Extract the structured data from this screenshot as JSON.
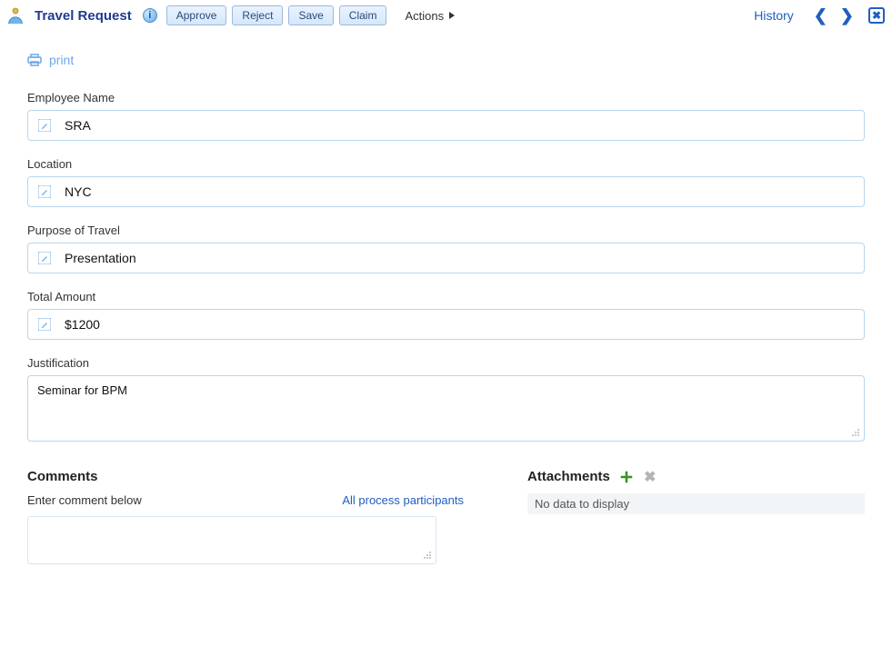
{
  "header": {
    "title": "Travel Request",
    "buttons": {
      "approve": "Approve",
      "reject": "Reject",
      "save": "Save",
      "claim": "Claim"
    },
    "actions_label": "Actions",
    "history_label": "History"
  },
  "print_label": "print",
  "fields": {
    "employee_name": {
      "label": "Employee Name",
      "value": "SRA"
    },
    "location": {
      "label": "Location",
      "value": "NYC"
    },
    "purpose": {
      "label": "Purpose of Travel",
      "value": "Presentation"
    },
    "total_amount": {
      "label": "Total Amount",
      "value": "$1200"
    },
    "justification": {
      "label": "Justification",
      "value": "Seminar for BPM"
    }
  },
  "comments": {
    "heading": "Comments",
    "hint": "Enter comment below",
    "participants_link": "All process participants",
    "value": ""
  },
  "attachments": {
    "heading": "Attachments",
    "empty_text": "No data to display"
  }
}
